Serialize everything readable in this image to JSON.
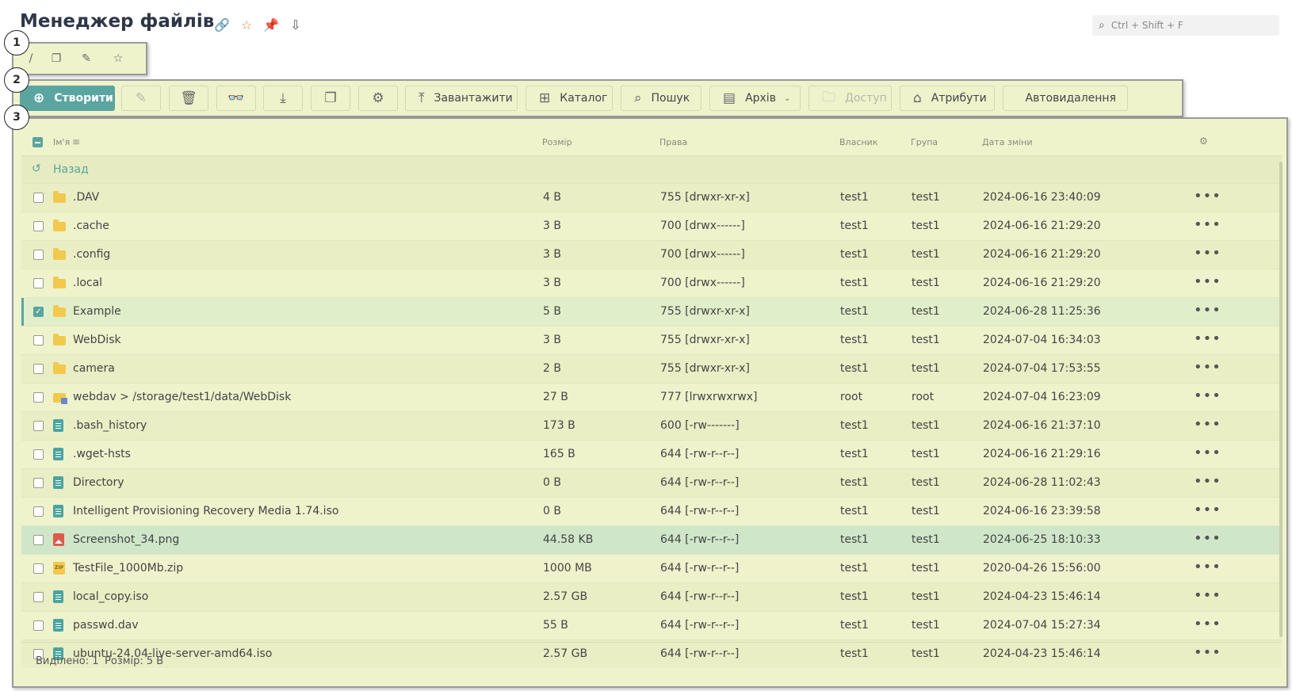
{
  "page": {
    "title": "Менеджер файлів"
  },
  "search": {
    "placeholder": "Ctrl + Shift + F"
  },
  "badges": [
    "1",
    "2",
    "3"
  ],
  "path_toolbar": {
    "root_label": "/"
  },
  "toolbar": {
    "create": "Створити",
    "upload": "Завантажити",
    "catalog": "Каталог",
    "search": "Пошук",
    "archive": "Архів",
    "access": "Доступ",
    "attributes": "Атрибути",
    "autodelete": "Автовидалення"
  },
  "table": {
    "headers": {
      "name": "Ім'я",
      "size": "Розмір",
      "rights": "Права",
      "owner": "Власник",
      "group": "Група",
      "modified": "Дата зміни"
    },
    "back_label": "Назад",
    "rows": [
      {
        "icon": "folder-icon",
        "name": ".DAV",
        "size": "4 B",
        "rights": "755 [drwxr-xr-x]",
        "owner": "test1",
        "group": "test1",
        "date": "2024-06-16 23:40:09",
        "checked": false
      },
      {
        "icon": "folder-icon",
        "name": ".cache",
        "size": "3 B",
        "rights": "700 [drwx------]",
        "owner": "test1",
        "group": "test1",
        "date": "2024-06-16 21:29:20",
        "checked": false
      },
      {
        "icon": "folder-icon",
        "name": ".config",
        "size": "3 B",
        "rights": "700 [drwx------]",
        "owner": "test1",
        "group": "test1",
        "date": "2024-06-16 21:29:20",
        "checked": false
      },
      {
        "icon": "folder-icon",
        "name": ".local",
        "size": "3 B",
        "rights": "700 [drwx------]",
        "owner": "test1",
        "group": "test1",
        "date": "2024-06-16 21:29:20",
        "checked": false
      },
      {
        "icon": "folder-icon",
        "name": "Example",
        "size": "5 B",
        "rights": "755 [drwxr-xr-x]",
        "owner": "test1",
        "group": "test1",
        "date": "2024-06-28 11:25:36",
        "checked": true
      },
      {
        "icon": "folder-icon",
        "name": "WebDisk",
        "size": "3 B",
        "rights": "755 [drwxr-xr-x]",
        "owner": "test1",
        "group": "test1",
        "date": "2024-07-04 16:34:03",
        "checked": false
      },
      {
        "icon": "folder-icon",
        "name": "camera",
        "size": "2 B",
        "rights": "755 [drwxr-xr-x]",
        "owner": "test1",
        "group": "test1",
        "date": "2024-07-04 17:53:55",
        "checked": false
      },
      {
        "icon": "link-folder-icon",
        "name": "webdav > /storage/test1/data/WebDisk",
        "size": "27 B",
        "rights": "777 [lrwxrwxrwx]",
        "owner": "root",
        "group": "root",
        "date": "2024-07-04 16:23:09",
        "checked": false
      },
      {
        "icon": "file-icon",
        "name": ".bash_history",
        "size": "173 B",
        "rights": "600 [-rw-------]",
        "owner": "test1",
        "group": "test1",
        "date": "2024-06-16 21:37:10",
        "checked": false
      },
      {
        "icon": "file-icon",
        "name": ".wget-hsts",
        "size": "165 B",
        "rights": "644 [-rw-r--r--]",
        "owner": "test1",
        "group": "test1",
        "date": "2024-06-16 21:29:16",
        "checked": false
      },
      {
        "icon": "file-icon",
        "name": "Directory",
        "size": "0 B",
        "rights": "644 [-rw-r--r--]",
        "owner": "test1",
        "group": "test1",
        "date": "2024-06-28 11:02:43",
        "checked": false
      },
      {
        "icon": "file-icon",
        "name": "Intelligent Provisioning Recovery Media 1.74.iso",
        "size": "0 B",
        "rights": "644 [-rw-r--r--]",
        "owner": "test1",
        "group": "test1",
        "date": "2024-06-16 23:39:58",
        "checked": false
      },
      {
        "icon": "image-icon",
        "name": "Screenshot_34.png",
        "size": "44.58 KB",
        "rights": "644 [-rw-r--r--]",
        "owner": "test1",
        "group": "test1",
        "date": "2024-06-25 18:10:33",
        "checked": false
      },
      {
        "icon": "zip-icon",
        "name": "TestFile_1000Mb.zip",
        "size": "1000 MB",
        "rights": "644 [-rw-r--r--]",
        "owner": "test1",
        "group": "test1",
        "date": "2020-04-26 15:56:00",
        "checked": false
      },
      {
        "icon": "file-icon",
        "name": "local_copy.iso",
        "size": "2.57 GB",
        "rights": "644 [-rw-r--r--]",
        "owner": "test1",
        "group": "test1",
        "date": "2024-04-23 15:46:14",
        "checked": false
      },
      {
        "icon": "file-icon",
        "name": "passwd.dav",
        "size": "55 B",
        "rights": "644 [-rw-r--r--]",
        "owner": "test1",
        "group": "test1",
        "date": "2024-07-04 15:27:34",
        "checked": false
      },
      {
        "icon": "file-icon",
        "name": "ubuntu-24.04-live-server-amd64.iso",
        "size": "2.57 GB",
        "rights": "644 [-rw-r--r--]",
        "owner": "test1",
        "group": "test1",
        "date": "2024-04-23 15:46:14",
        "checked": false
      }
    ]
  },
  "footer": {
    "selected": "Виділено: 1",
    "size": "Розмір: 5 B"
  },
  "colors": {
    "accent": "#5aa5a0",
    "panel_bg": "#eef3cc",
    "star": "#e58b3a",
    "folder": "#f2c94c"
  }
}
